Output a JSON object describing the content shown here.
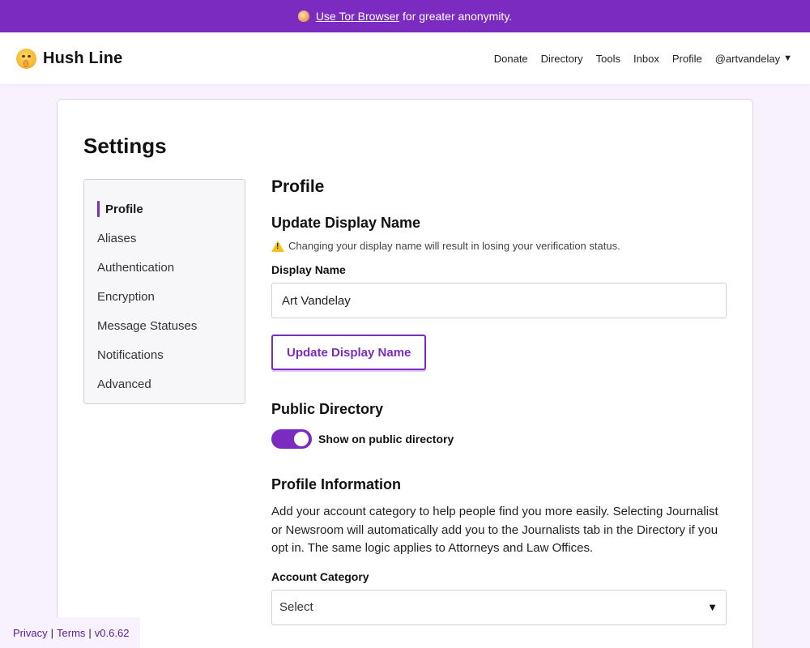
{
  "banner": {
    "link_text": "Use Tor Browser",
    "suffix": "for greater anonymity.",
    "icon": "onion-icon",
    "color": "#7b2bbf"
  },
  "header": {
    "brand": "Hush Line",
    "brand_icon": "shushing-face-icon",
    "nav": [
      "Donate",
      "Directory",
      "Tools",
      "Inbox",
      "Profile"
    ],
    "user": "@artvandelay"
  },
  "page": {
    "title": "Settings"
  },
  "sidebar": {
    "items": [
      {
        "label": "Profile",
        "active": true
      },
      {
        "label": "Aliases"
      },
      {
        "label": "Authentication"
      },
      {
        "label": "Encryption"
      },
      {
        "label": "Message Statuses"
      },
      {
        "label": "Notifications"
      },
      {
        "label": "Advanced"
      }
    ]
  },
  "profile": {
    "heading": "Profile",
    "display_name": {
      "heading": "Update Display Name",
      "warning": "Changing your display name will result in losing your verification status.",
      "label": "Display Name",
      "value": "Art Vandelay",
      "button": "Update Display Name"
    },
    "directory": {
      "heading": "Public Directory",
      "toggle_label": "Show on public directory",
      "enabled": true
    },
    "info": {
      "heading": "Profile Information",
      "description": "Add your account category to help people find you more easily. Selecting Journalist or Newsroom will automatically add you to the Journalists tab in the Directory if you opt in. The same logic applies to Attorneys and Law Offices.",
      "category_label": "Account Category",
      "category_value": "Select"
    }
  },
  "footer": {
    "privacy": "Privacy",
    "terms": "Terms",
    "version": "v0.6.62",
    "separator": "|"
  }
}
